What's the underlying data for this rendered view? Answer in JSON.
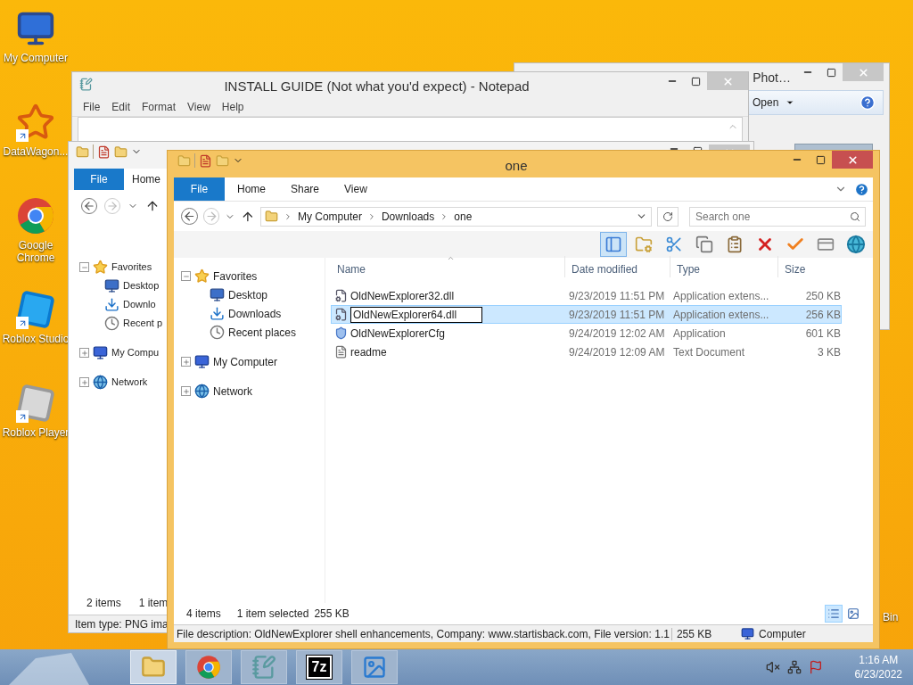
{
  "desktop": {
    "icons": [
      {
        "label": "My Computer",
        "kind": "computer",
        "shortcut": false
      },
      {
        "label": "DataWagon...",
        "kind": "datawagon",
        "shortcut": true
      },
      {
        "label": "Google Chrome",
        "kind": "chrome",
        "shortcut": false
      },
      {
        "label": "Roblox Studio",
        "kind": "studio",
        "shortcut": true
      },
      {
        "label": "Roblox Player",
        "kind": "player",
        "shortcut": true
      }
    ],
    "edge_label": "Bin"
  },
  "photo_viewer": {
    "title": "Phot…",
    "menu": "Open"
  },
  "notepad": {
    "title": "INSTALL GUIDE (Not what you'd expect) - Notepad",
    "menu": [
      "File",
      "Edit",
      "Format",
      "View",
      "Help"
    ]
  },
  "back_explorer": {
    "file_tab": "File",
    "tabs": [
      "Home"
    ],
    "tree": [
      {
        "label": "Favorites",
        "kind": "star",
        "expanded": true,
        "children": [
          {
            "label": "Desktop",
            "kind": "desktop"
          },
          {
            "label": "Downlo",
            "kind": "downloads"
          },
          {
            "label": "Recent p",
            "kind": "recent"
          }
        ]
      },
      {
        "label": "My Compu",
        "kind": "computer",
        "expanded": false
      },
      {
        "label": "Network",
        "kind": "network",
        "expanded": false
      }
    ],
    "status": [
      "2 items",
      "1 item"
    ],
    "details": "Item type: PNG ima"
  },
  "explorer": {
    "title": "one",
    "file_tab": "File",
    "tabs": [
      "Home",
      "Share",
      "View"
    ],
    "path": [
      "My Computer",
      "Downloads",
      "one"
    ],
    "search": {
      "placeholder": "Search one"
    },
    "toolbar": [
      {
        "kind": "layout",
        "selected": true
      },
      {
        "kind": "folder-options",
        "selected": false
      },
      {
        "kind": "cut",
        "selected": false
      },
      {
        "kind": "copy",
        "selected": false
      },
      {
        "kind": "paste",
        "selected": false
      },
      {
        "kind": "delete",
        "selected": false
      },
      {
        "kind": "check",
        "selected": false
      },
      {
        "kind": "rename",
        "selected": false
      },
      {
        "kind": "globe",
        "selected": false
      }
    ],
    "tree": [
      {
        "label": "Favorites",
        "kind": "star",
        "expanded": true,
        "children": [
          {
            "label": "Desktop",
            "kind": "desktop"
          },
          {
            "label": "Downloads",
            "kind": "downloads"
          },
          {
            "label": "Recent places",
            "kind": "recent"
          }
        ]
      },
      {
        "label": "My Computer",
        "kind": "computer",
        "expanded": false
      },
      {
        "label": "Network",
        "kind": "network",
        "expanded": false
      }
    ],
    "columns": [
      {
        "label": "Name",
        "sorted": true
      },
      {
        "label": "Date modified",
        "sorted": false
      },
      {
        "label": "Type",
        "sorted": false
      },
      {
        "label": "Size",
        "sorted": false
      }
    ],
    "files": [
      {
        "name": "OldNewExplorer32.dll",
        "date": "9/23/2019 11:51 PM",
        "type": "Application extens...",
        "size": "250 KB",
        "kind": "dll",
        "selected": false,
        "renaming": false
      },
      {
        "name": "OldNewExplorer64.dll",
        "date": "9/23/2019 11:51 PM",
        "type": "Application extens...",
        "size": "256 KB",
        "kind": "dll",
        "selected": true,
        "renaming": true
      },
      {
        "name": "OldNewExplorerCfg",
        "date": "9/24/2019 12:02 AM",
        "type": "Application",
        "size": "601 KB",
        "kind": "app",
        "selected": false,
        "renaming": false
      },
      {
        "name": "readme",
        "date": "9/24/2019 12:09 AM",
        "type": "Text Document",
        "size": "3 KB",
        "kind": "text",
        "selected": false,
        "renaming": false
      }
    ],
    "status": {
      "count": "4 items",
      "selection": "1 item selected",
      "selection_size": "255 KB"
    },
    "views": [
      {
        "kind": "details",
        "selected": true
      },
      {
        "kind": "thumbnails",
        "selected": false
      }
    ],
    "details_bar": {
      "description": "File description: OldNewExplorer shell enhancements, Company: www.startisback.com, File version: 1.1",
      "size": "255 KB",
      "location": "Computer"
    }
  },
  "taskbar": {
    "apps": [
      {
        "kind": "explorer",
        "active": true
      },
      {
        "kind": "chrome",
        "active": false
      },
      {
        "kind": "notepad",
        "active": false
      },
      {
        "kind": "archiver",
        "active": false,
        "label": "7z"
      },
      {
        "kind": "photos",
        "active": false
      }
    ],
    "tray": [
      {
        "kind": "volume-muted"
      },
      {
        "kind": "network"
      },
      {
        "kind": "flag"
      }
    ],
    "time": "1:16 AM",
    "date": "6/23/2022"
  }
}
